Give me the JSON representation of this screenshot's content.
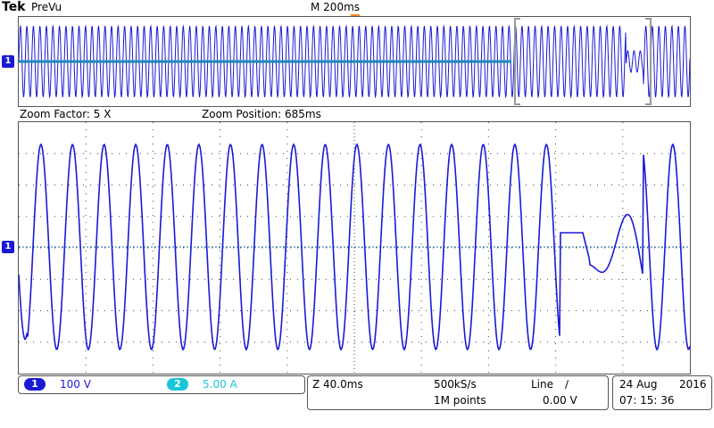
{
  "header": {
    "brand": "Tek",
    "mode": "PreVu",
    "timebase": "M 200ms"
  },
  "zoom": {
    "factor": "Zoom Factor: 5 X",
    "position": "Zoom Position: 685ms"
  },
  "markers": {
    "ch1": "1"
  },
  "channels": [
    {
      "badge": "1",
      "scale": "100 V",
      "color": "#1a1ad6",
      "text_color": "#1a1ad6"
    },
    {
      "badge": "2",
      "scale": "5.00 A",
      "color": "#19c6d8",
      "text_color": "#19c6d8"
    }
  ],
  "acquisition": {
    "zoom_timebase": "Z 40.0ms",
    "sample_rate": "500kS/s",
    "record_length": "1M points",
    "trigger_source": "Line",
    "trigger_slope": "∕",
    "trigger_level": "0.00 V"
  },
  "datetime": {
    "date": "24 Aug",
    "year": "2016",
    "time": "07: 15: 36"
  },
  "colors": {
    "trace": "#1a1ad6",
    "grid": "#444444",
    "trigger_marker": "#f08a1c"
  }
}
